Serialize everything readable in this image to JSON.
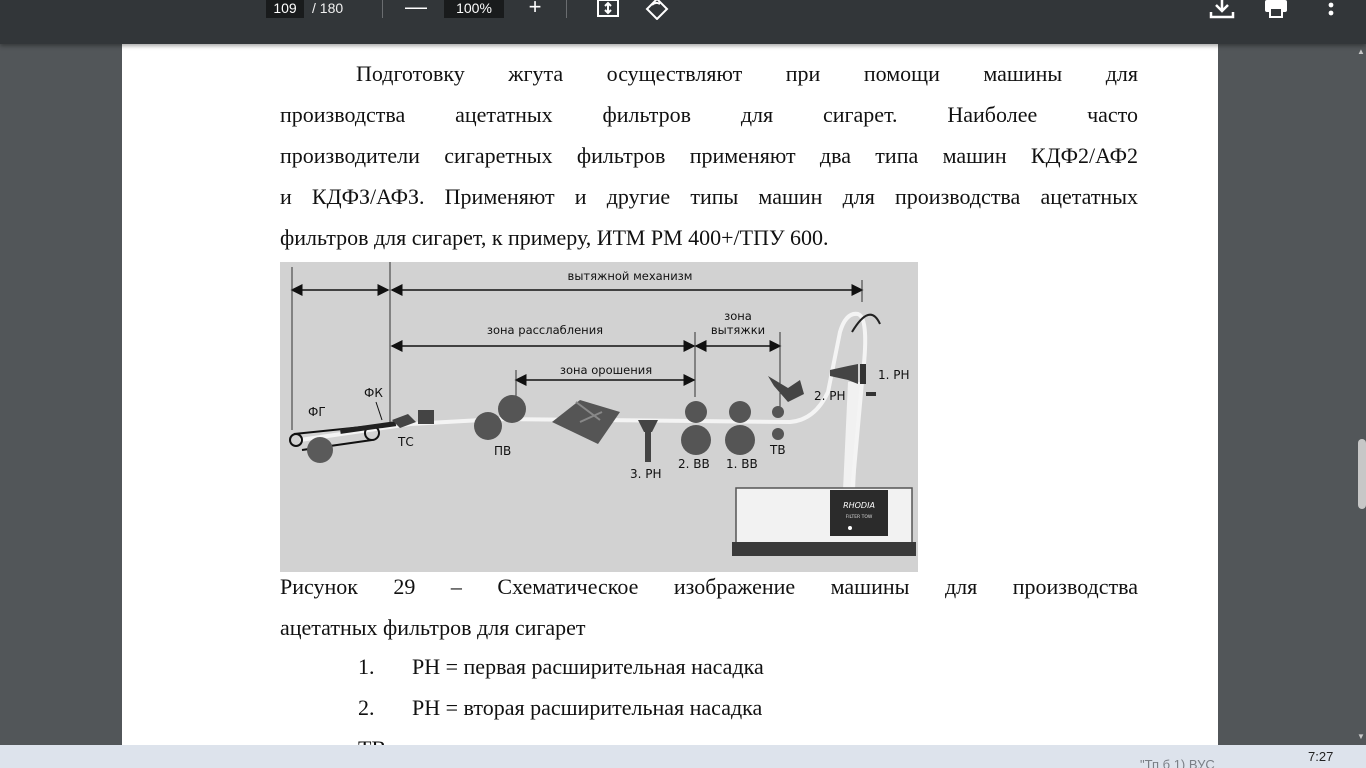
{
  "toolbar": {
    "page_current": "109",
    "page_total": "/ 180",
    "zoom_out": "—",
    "zoom_value": "100%",
    "zoom_in": "+",
    "icons": [
      "fit-page-icon",
      "rotate-icon",
      "download-icon",
      "print-icon",
      "more-options-icon"
    ]
  },
  "document": {
    "paragraph_lines": [
      "Подготовку жгута осуществляют при помощи машины для",
      "производства ацетатных фильтров для сигарет. Наиболее часто",
      "производители сигаретных фильтров применяют два типа машин КДФ2/АФ2",
      "и КДФЗ/АФЗ. Применяют и другие типы машин для производства ацетатных",
      "фильтров для сигарет, к примеру, ИТМ РМ 400+/ТПУ 600."
    ],
    "caption_lines": [
      "Рисунок 29 – Схематическое изображение машины для производства",
      "ацетатных фильтров для сигарет"
    ],
    "list": [
      {
        "num": "1.",
        "text": "РН = первая расширительная насадка"
      },
      {
        "num": "2.",
        "text": "РН = вторая расширительная насадка"
      }
    ],
    "cut_line": "ТВ = пара тормозных валиков"
  },
  "figure": {
    "labels": {
      "stretch_mechanism": "вытяжной механизм",
      "relax_zone": "зона расслабления",
      "stretch_zone_1": "зона",
      "stretch_zone_2": "вытяжки",
      "spray_zone": "зона орошения",
      "fg": "ФГ",
      "fk": "ФК",
      "tc": "ТС",
      "pv": "ПВ",
      "rh3": "3. РН",
      "vv2": "2. ВВ",
      "vv1": "1. ВВ",
      "tv": "ТВ",
      "rh2": "2. РН",
      "rh1": "1. РН",
      "brand": "RHODIA",
      "brand_sub": "FILTER TOW"
    }
  },
  "taskbar": {
    "tray_text": "\"Тп б 1) ВУС",
    "clock": "7:27"
  },
  "colors": {
    "toolbar_bg": "#323639",
    "viewer_bg": "#525659",
    "figure_bg": "#d2d2d2"
  }
}
